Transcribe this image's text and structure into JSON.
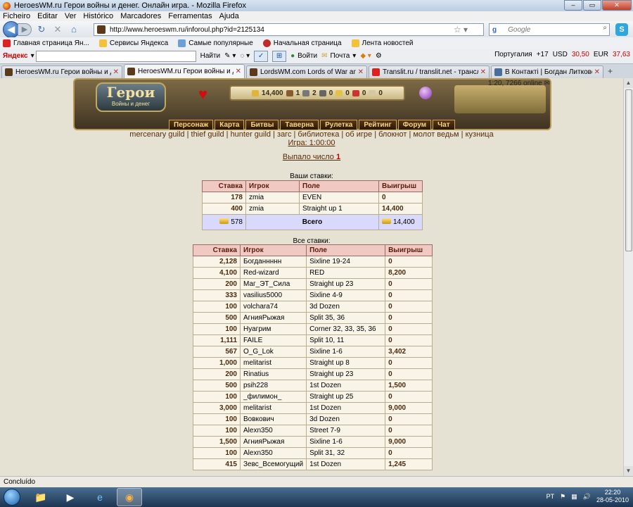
{
  "window": {
    "title": "HeroesWM.ru Герои войны и денег. Онлайн игра. - Mozilla Firefox"
  },
  "menu": [
    "Ficheiro",
    "Editar",
    "Ver",
    "Histórico",
    "Marcadores",
    "Ferramentas",
    "Ajuda"
  ],
  "nav": {
    "url": "http://www.heroeswm.ru/inforoul.php?id=2125134",
    "search_placeholder": "Google",
    "search_engine_label": "g"
  },
  "bookmarks": [
    "Главная страница Ян...",
    "Сервисы Яндекса",
    "Самые популярные",
    "Начальная страница",
    "Лента новостей"
  ],
  "yandex_bar": {
    "label": "Яндекс",
    "find": "Найти",
    "login": "Войти",
    "mail": "Почта",
    "location": "Португалия",
    "temp": "+17",
    "usd_label": "USD",
    "usd": "30,50",
    "eur_label": "EUR",
    "eur": "37,63"
  },
  "tabs": [
    {
      "label": "HeroesWM.ru Герои войны и ден...",
      "active": false
    },
    {
      "label": "HeroesWM.ru Герои войны и д...",
      "active": true
    },
    {
      "label": "LordsWM.com Lords of War and ...",
      "active": false
    },
    {
      "label": "Translit.ru / translit.net - трансли...",
      "active": false
    },
    {
      "label": "В Контакті | Богдан Литковец",
      "active": false
    }
  ],
  "game_header": {
    "logo_title": "Герои",
    "logo_sub": "Войны и денег",
    "gold": "14,400",
    "res1": "1",
    "res2": "2",
    "res3": "0",
    "res4": "0",
    "res5": "0",
    "res6": "0",
    "online": "1:20, 7266 online",
    "nav": [
      "Персонаж",
      "Карта",
      "Битвы",
      "Таверна",
      "Рулетка",
      "Рейтинг",
      "Форум",
      "Чат"
    ]
  },
  "sublinks": "mercenary guild | thief guild | hunter guild | загс | библиотека | об игре | блокнот | молот ведьм | кузница",
  "game_time": "Игра: 1:00:00",
  "result": {
    "text": "Выпало число",
    "number": "1"
  },
  "your_bets": {
    "caption": "Ваши ставки:",
    "headers": [
      "Ставка",
      "Игрок",
      "Поле",
      "Выигрыш"
    ],
    "rows": [
      [
        "178",
        "zmia",
        "EVEN",
        "0"
      ],
      [
        "400",
        "zmia",
        "Straight up 1",
        "14,400"
      ]
    ],
    "total_bet": "578",
    "total_label": "Всего",
    "total_win": "14,400"
  },
  "all_bets": {
    "caption": "Все ставки:",
    "headers": [
      "Ставка",
      "Игрок",
      "Поле",
      "Выигрыш"
    ],
    "rows": [
      [
        "2,128",
        "Богданнннн",
        "Sixline 19-24",
        "0"
      ],
      [
        "4,100",
        "Red-wizard",
        "RED",
        "8,200"
      ],
      [
        "200",
        "Маг_ЭТ_Сила",
        "Straight up 23",
        "0"
      ],
      [
        "333",
        "vasilius5000",
        "Sixline 4-9",
        "0"
      ],
      [
        "100",
        "volchara74",
        "3d Dozen",
        "0"
      ],
      [
        "500",
        "АгнияРыжая",
        "Split 35, 36",
        "0"
      ],
      [
        "100",
        "Нуагрим",
        "Corner 32, 33, 35, 36",
        "0"
      ],
      [
        "1,111",
        "FAILE",
        "Split 10, 11",
        "0"
      ],
      [
        "567",
        "O_G_Lok",
        "Sixline 1-6",
        "3,402"
      ],
      [
        "1,000",
        "melitarist",
        "Straight up 8",
        "0"
      ],
      [
        "200",
        "Rinatius",
        "Straight up 23",
        "0"
      ],
      [
        "500",
        "psih228",
        "1st Dozen",
        "1,500"
      ],
      [
        "100",
        "_филимон_",
        "Straight up 25",
        "0"
      ],
      [
        "3,000",
        "melitarist",
        "1st Dozen",
        "9,000"
      ],
      [
        "100",
        "Вовкович",
        "3d Dozen",
        "0"
      ],
      [
        "100",
        "Alexn350",
        "Street 7-9",
        "0"
      ],
      [
        "1,500",
        "АгнияРыжая",
        "Sixline 1-6",
        "9,000"
      ],
      [
        "100",
        "Alexn350",
        "Split 31, 32",
        "0"
      ],
      [
        "415",
        "Зевс_Всемогущий",
        "1st Dozen",
        "1,245"
      ]
    ]
  },
  "status": "Concluído",
  "taskbar": {
    "lang": "PT",
    "time": "22:20",
    "date": "28-05-2010"
  }
}
